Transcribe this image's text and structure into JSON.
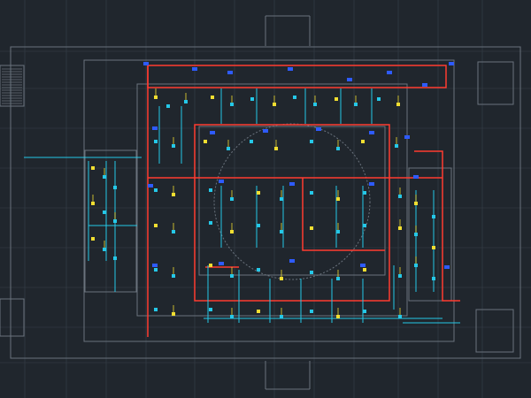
{
  "title": "",
  "colors": {
    "background": "#20262d",
    "grid": "#3a424b",
    "architecture": "#6a737d",
    "duct_red": "#ff3b30",
    "duct_cyan": "#25c8e8",
    "blue": "#2e5bff",
    "yellow": "#f1de31",
    "green": "#35d35a"
  },
  "sheet_label": "",
  "notes": [
    "",
    "",
    "",
    "",
    ""
  ],
  "legend_entries": []
}
